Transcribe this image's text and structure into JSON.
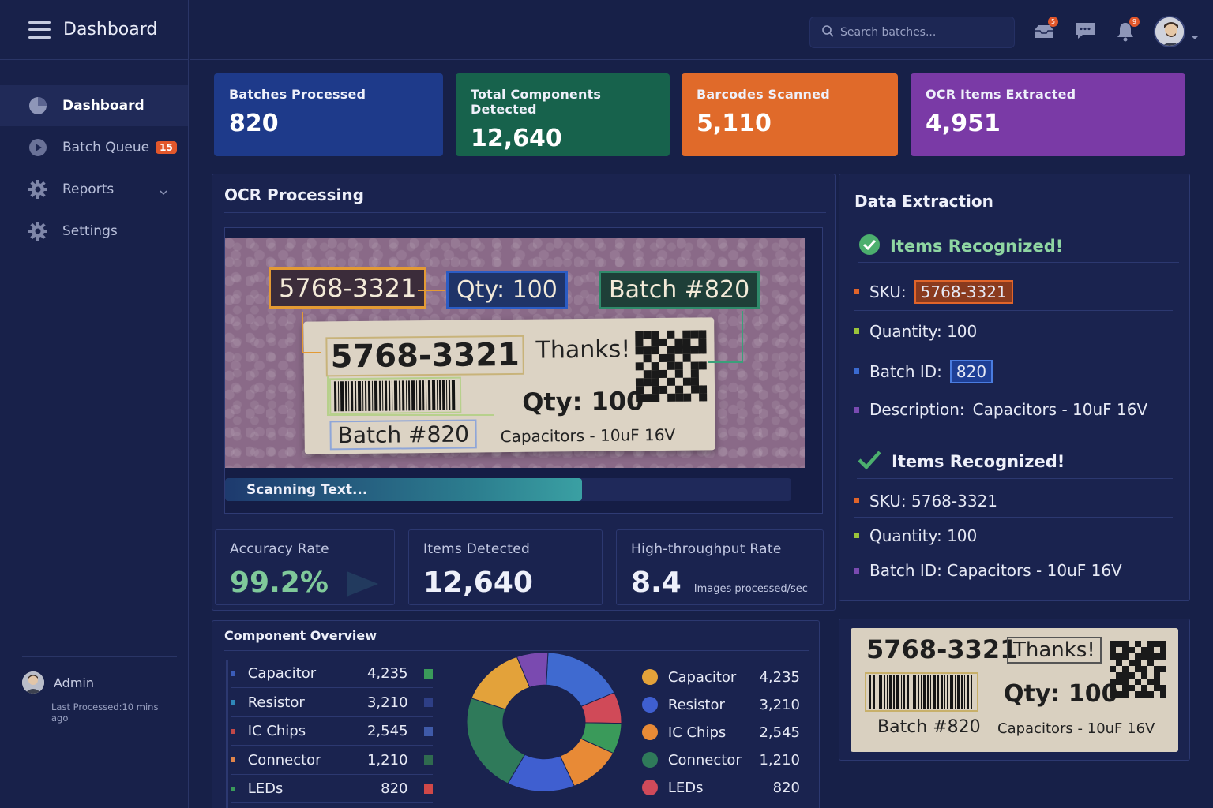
{
  "app": {
    "title": "Dashboard"
  },
  "sidebar": {
    "items": [
      {
        "label": "Dashboard",
        "icon": "pie-chart-icon",
        "active": true
      },
      {
        "label": "Batch Queue",
        "icon": "play-icon",
        "badge": "15"
      },
      {
        "label": "Reports",
        "icon": "gear-icon",
        "has_chevron": true
      },
      {
        "label": "Settings",
        "icon": "gear-icon"
      }
    ],
    "user": {
      "name": "Admin",
      "meta": "Last Processed:10 mins ago"
    }
  },
  "topbar": {
    "search_placeholder": "Search batches...",
    "inbox_badge": "5",
    "notifications_badge": "9"
  },
  "stats": [
    {
      "label": "Batches Processed",
      "value": "820",
      "color": "#1e3a8a"
    },
    {
      "label": "Total Components Detected",
      "value": "12,640",
      "color": "#17624c"
    },
    {
      "label": "Barcodes Scanned",
      "value": "5,110",
      "color": "#e06a2a"
    },
    {
      "label": "OCR Items Extracted",
      "value": "4,951",
      "color": "#7a3aa6"
    }
  ],
  "ocr": {
    "title": "OCR Processing",
    "tags": {
      "sku": "5768-3321",
      "qty": "Qty: 100",
      "batch": "Batch #820"
    },
    "label": {
      "sku": "5768-3321",
      "thanks": "Thanks!",
      "qty": "Qty: 100",
      "batch": "Batch #820",
      "desc": "Capacitors - 10uF 16V"
    },
    "progress_text": "Scanning Text...",
    "progress": 0.63
  },
  "metrics": [
    {
      "label": "Accuracy Rate",
      "value": "99.2%"
    },
    {
      "label": "Items Detected",
      "value": "12,640"
    },
    {
      "label": "High-throughput Rate",
      "value": "8.4",
      "unit": "Images processed/sec"
    }
  ],
  "extraction": {
    "title": "Data Extraction",
    "section1": {
      "heading": "Items Recognized!",
      "sku_label": "SKU:",
      "sku_value": "5768-3321",
      "qty": "Quantity: 100",
      "batch_label": "Batch ID:",
      "batch_value": "820",
      "desc_label": "Description:",
      "desc_value": "Capacitors - 10uF 16V"
    },
    "section2": {
      "heading": "Items Recognized!",
      "sku": "SKU: 5768-3321",
      "qty": "Quantity: 100",
      "batch": "Batch ID: Capacitors - 10uF 16V"
    }
  },
  "thumbnail": {
    "sku": "5768-3321",
    "thanks": "Thanks!",
    "qty": "Qty: 100",
    "batch": "Batch #820",
    "desc": "Capacitors - 10uF 16V"
  },
  "component_overview": {
    "title": "Component Overview",
    "rows": [
      {
        "name": "Capacitor",
        "value": "4,235",
        "bullet": "#3b5cb8",
        "square": "#3a9a5a"
      },
      {
        "name": "Resistor",
        "value": "3,210",
        "bullet": "#2f87b8",
        "square": "#2e3f86"
      },
      {
        "name": "IC Chips",
        "value": "2,545",
        "bullet": "#c24848",
        "square": "#3f5aa8"
      },
      {
        "name": "Connector",
        "value": "1,210",
        "bullet": "#e0844a",
        "square": "#2f6b4f"
      },
      {
        "name": "LEDs",
        "value": "820",
        "bullet": "#3a9a5a",
        "square": "#d04848"
      }
    ],
    "legend": [
      {
        "name": "Capacitor",
        "value": "4,235",
        "color": "#e3a23a"
      },
      {
        "name": "Resistor",
        "value": "3,210",
        "color": "#3f5fd0"
      },
      {
        "name": "IC Chips",
        "value": "2,545",
        "color": "#e88a36"
      },
      {
        "name": "Connector",
        "value": "1,210",
        "color": "#2f7a5a"
      },
      {
        "name": "LEDs",
        "value": "820",
        "color": "#cf4a5a"
      }
    ]
  },
  "chart_data": {
    "type": "pie",
    "donut": true,
    "categories": [
      "Capacitor",
      "Resistor",
      "IC Chips",
      "Connector",
      "LEDs"
    ],
    "values": [
      4235,
      3210,
      2545,
      1210,
      820
    ]
  },
  "colors": {
    "background": "#172048",
    "panel": "#1a234f",
    "accuracy": "#7fc99a"
  }
}
